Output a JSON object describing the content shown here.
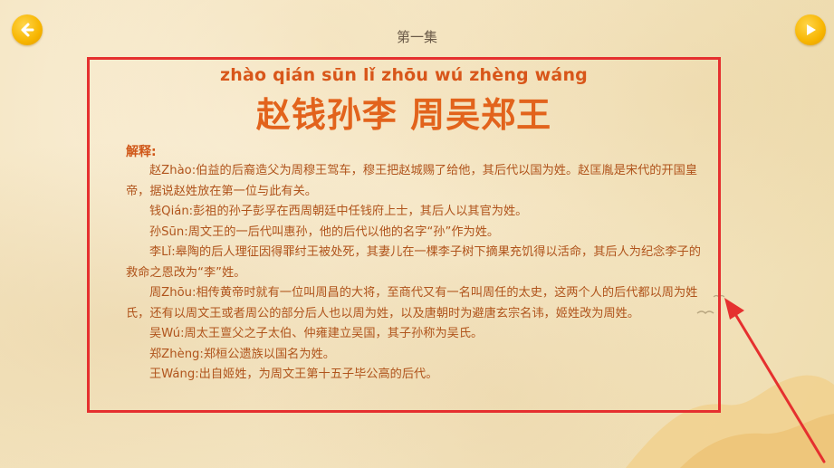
{
  "header": {
    "episode": "第一集"
  },
  "nav": {
    "back_icon": "arrow-left-icon",
    "next_icon": "play-icon"
  },
  "verse": {
    "pinyin": "zhào qián sūn lǐ zhōu wú zhèng wáng",
    "hanzi": "赵钱孙李 周吴郑王"
  },
  "explanation": {
    "label": "解释:",
    "entries": [
      "赵Zhào:伯益的后裔造父为周穆王驾车，穆王把赵城赐了给他，其后代以国为姓。赵匡胤是宋代的开国皇帝，据说赵姓放在第一位与此有关。",
      "钱Qián:彭祖的孙子彭孚在西周朝廷中任钱府上士，其后人以其官为姓。",
      "孙Sūn:周文王的一后代叫惠孙，他的后代以他的名字“孙”作为姓。",
      "李Lǐ:皋陶的后人理征因得罪纣王被处死，其妻儿在一棵李子树下摘果充饥得以活命，其后人为纪念李子的救命之恩改为“李”姓。",
      "周Zhōu:相传黄帝时就有一位叫周昌的大将，至商代又有一名叫周任的太史，这两个人的后代都以周为姓氏，还有以周文王或者周公的部分后人也以周为姓，以及唐朝时为避唐玄宗名讳，姬姓改为周姓。",
      "吴Wú:周太王亶父之子太伯、仲雍建立吴国，其子孙称为吴氏。",
      "郑Zhèng:郑桓公遗族以国名为姓。",
      "王Wáng:出自姬姓，为周文王第十五子毕公高的后代。"
    ]
  },
  "colors": {
    "accent_orange": "#e2631c",
    "highlight_red": "#e5302f",
    "button_yellow": "#f7b500"
  }
}
